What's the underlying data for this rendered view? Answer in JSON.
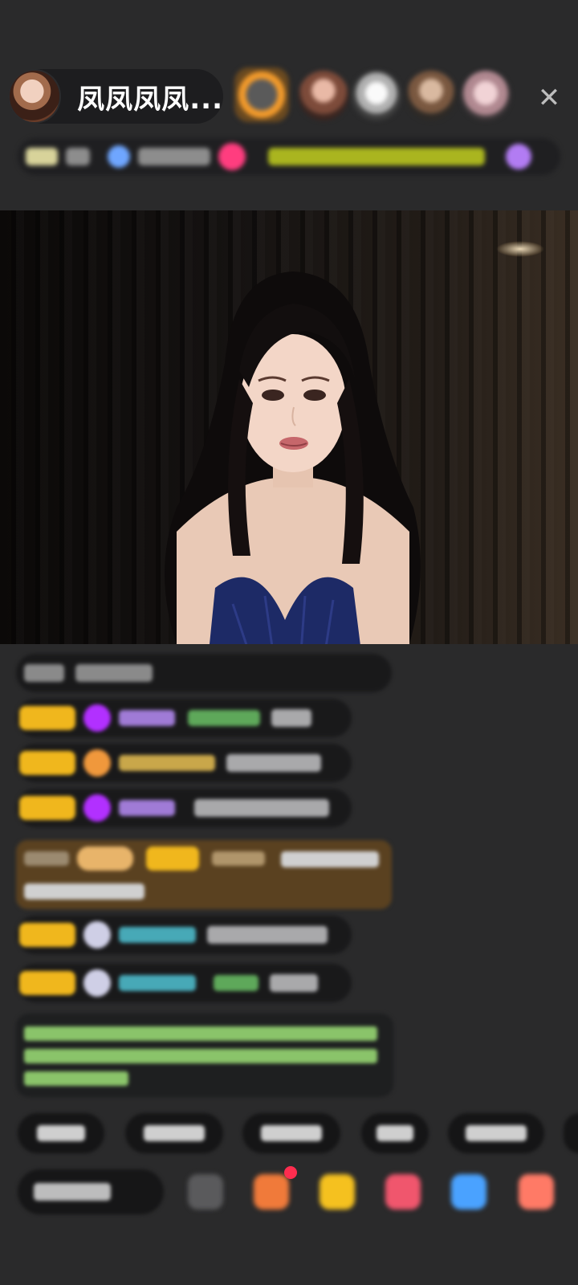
{
  "header": {
    "host_name": "凤凤凤凤...",
    "close_symbol": "✕",
    "viewers": [
      "viewer-1",
      "viewer-2",
      "viewer-3",
      "viewer-4",
      "viewer-5"
    ]
  },
  "colors": {
    "background": "#2a2a2b",
    "level_badge": "#f0b71d",
    "notice_text": "#8ac46a",
    "gift_highlight": "#5a4120",
    "badge_red": "#ff2d4f"
  },
  "video": {
    "scene": "live-stream-video"
  },
  "chat": {
    "rows": [
      "row-1",
      "row-2",
      "row-3",
      "row-4",
      "row-5",
      "row-6",
      "row-7",
      "row-8"
    ]
  },
  "quick_replies": [
    "qr-1",
    "qr-2",
    "qr-3",
    "qr-4",
    "qr-5"
  ],
  "bottom_bar": {
    "icons": [
      "emoji-icon",
      "gift-box-icon",
      "treasure-icon",
      "lips-icon",
      "game-icon",
      "gift-icon"
    ]
  }
}
